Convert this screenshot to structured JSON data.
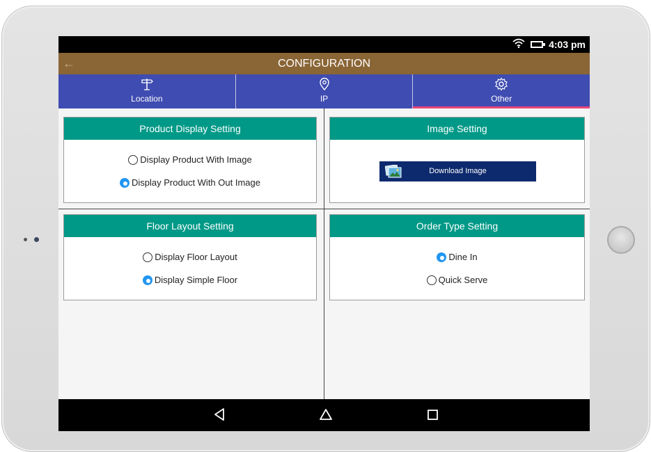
{
  "status": {
    "time": "4:03 pm"
  },
  "header": {
    "title": "CONFIGURATION"
  },
  "tabs": [
    {
      "label": "Location",
      "icon": "signpost-icon"
    },
    {
      "label": "IP",
      "icon": "location-pin-icon"
    },
    {
      "label": "Other",
      "icon": "gear-icon",
      "active": true
    }
  ],
  "cards": {
    "product_display": {
      "title": "Product Display Setting",
      "options": [
        {
          "label": "Display Product With Image",
          "selected": false
        },
        {
          "label": "Display Product With Out Image",
          "selected": true
        }
      ]
    },
    "image_setting": {
      "title": "Image Setting",
      "button_label": "Download Image"
    },
    "floor_layout": {
      "title": "Floor Layout Setting",
      "options": [
        {
          "label": "Display Floor Layout",
          "selected": false
        },
        {
          "label": "Display Simple Floor",
          "selected": true
        }
      ]
    },
    "order_type": {
      "title": "Order Type Setting",
      "options": [
        {
          "label": "Dine In",
          "selected": true
        },
        {
          "label": "Quick Serve",
          "selected": false
        }
      ]
    }
  },
  "colors": {
    "title_bar": "#8a6535",
    "tab_bar": "#3f4cb1",
    "tab_indicator": "#e8467a",
    "card_header": "#009987",
    "radio_checked": "#2196f3",
    "download_button": "#0e2a6e"
  }
}
